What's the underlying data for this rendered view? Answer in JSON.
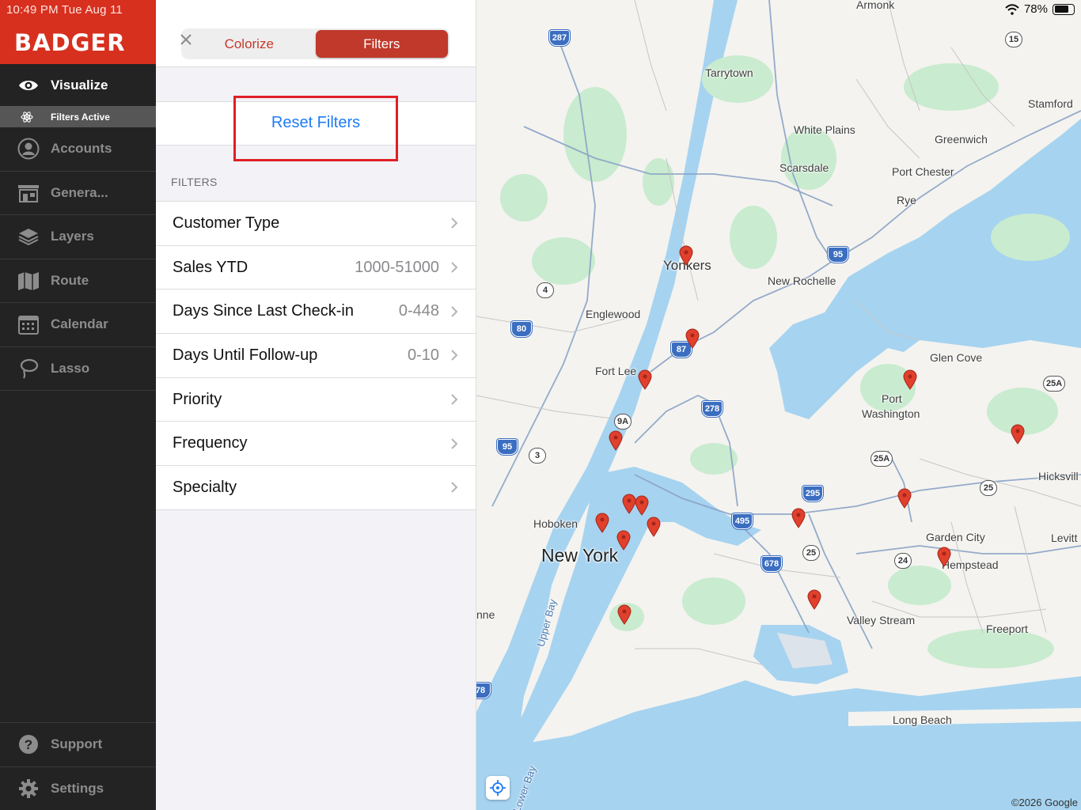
{
  "status": {
    "time": "10:49 PM   Tue Aug 11",
    "battery": "78%"
  },
  "brand": {
    "logo": "BADGER",
    "color": "#d7301f"
  },
  "sidebar": {
    "items": [
      {
        "label": "Visualize",
        "icon": "eye-icon",
        "active": true
      },
      {
        "label": "Accounts",
        "icon": "person-circle-icon"
      },
      {
        "label": "Genera...",
        "icon": "storefront-icon"
      },
      {
        "label": "Layers",
        "icon": "layers-icon"
      },
      {
        "label": "Route",
        "icon": "map-icon"
      },
      {
        "label": "Calendar",
        "icon": "calendar-icon"
      },
      {
        "label": "Lasso",
        "icon": "lasso-icon"
      }
    ],
    "filters_active": "Filters Active",
    "bottom": [
      {
        "label": "Support",
        "icon": "question-circle-icon"
      },
      {
        "label": "Settings",
        "icon": "gear-icon"
      }
    ]
  },
  "panel": {
    "tabs": [
      {
        "label": "Colorize",
        "selected": false
      },
      {
        "label": "Filters",
        "selected": true
      }
    ],
    "reset_label": "Reset Filters",
    "section_title": "FILTERS",
    "filters": [
      {
        "label": "Customer Type",
        "value": ""
      },
      {
        "label": "Sales YTD",
        "value": "1000-51000"
      },
      {
        "label": "Days Since Last Check-in",
        "value": "0-448"
      },
      {
        "label": "Days Until Follow-up",
        "value": "0-10"
      },
      {
        "label": "Priority",
        "value": ""
      },
      {
        "label": "Frequency",
        "value": ""
      },
      {
        "label": "Specialty",
        "value": ""
      }
    ]
  },
  "map": {
    "labels": {
      "armonk": "Armonk",
      "tarrytown": "Tarrytown",
      "stamford": "Stamford",
      "white_plains": "White Plains",
      "greenwich": "Greenwich",
      "scarsdale": "Scarsdale",
      "port_chester": "Port Chester",
      "rye": "Rye",
      "yonkers": "Yonkers",
      "new_rochelle": "New Rochelle",
      "englewood": "Englewood",
      "glen_cove": "Glen Cove",
      "fort_lee": "Fort Lee",
      "port": "Port",
      "washington": "Washington",
      "hicksville": "Hicksvill",
      "hoboken": "Hoboken",
      "new_york": "New York",
      "garden_city": "Garden City",
      "hempstead": "Hempstead",
      "levitt": "Levitt",
      "upper_bay": "Upper Bay",
      "valley_stream": "Valley Stream",
      "freeport": "Freeport",
      "long_beach": "Long Beach",
      "lower_bay": "Lower Bay",
      "nne": "nne"
    },
    "shields": [
      "287",
      "15",
      "95",
      "4",
      "80",
      "87",
      "278",
      "9A",
      "95",
      "3",
      "25A",
      "25A",
      "295",
      "495",
      "25",
      "678",
      "25",
      "24",
      "78"
    ],
    "copyright": "©2026 Google",
    "water_color": "#a6d3f0",
    "park_color": "#c9ebcf",
    "pin_color": "#e0402c"
  }
}
